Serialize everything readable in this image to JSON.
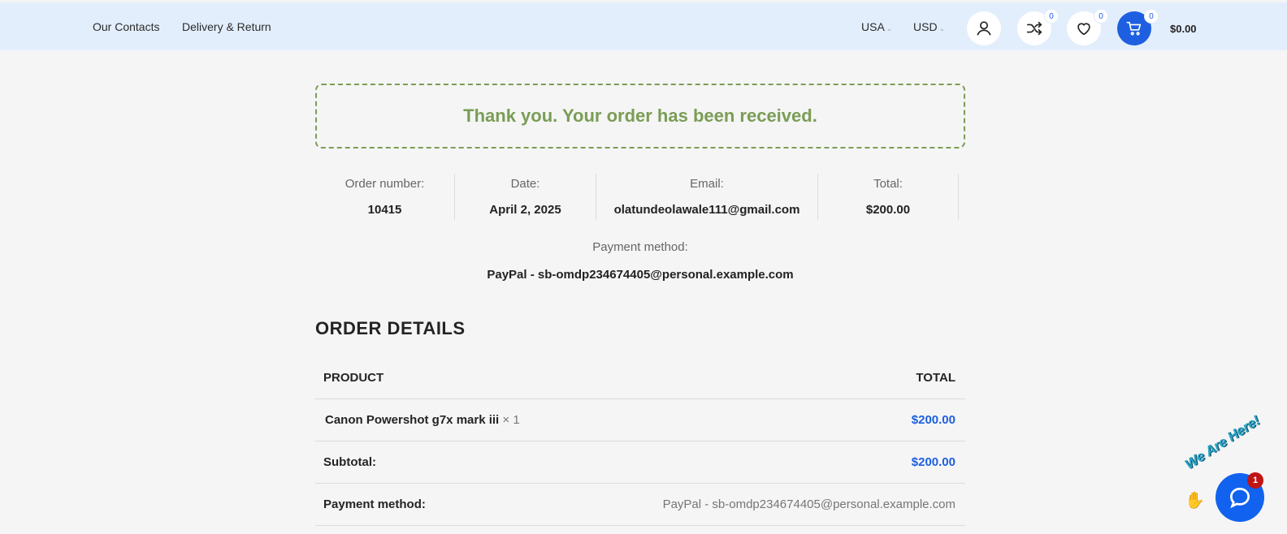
{
  "header": {
    "links": [
      "Our Contacts",
      "Delivery & Return"
    ],
    "country": "USA",
    "currency": "USD",
    "compare_count": "0",
    "wishlist_count": "0",
    "cart_count": "0",
    "cart_total": "$0.00"
  },
  "notice": "Thank you. Your order has been received.",
  "overview": [
    {
      "label": "Order number:",
      "value": "10415"
    },
    {
      "label": "Date:",
      "value": "April 2, 2025"
    },
    {
      "label": "Email:",
      "value": "olatundeolawale111@gmail.com"
    },
    {
      "label": "Total:",
      "value": "$200.00"
    }
  ],
  "payment": {
    "label": "Payment method:",
    "value": "PayPal - sb-omdp234674405@personal.example.com"
  },
  "order_details": {
    "title": "ORDER DETAILS",
    "columns": [
      "PRODUCT",
      "TOTAL"
    ],
    "items": [
      {
        "name": "Canon Powershot g7x mark iii",
        "qty": "× 1",
        "total": "$200.00"
      }
    ],
    "subtotal_label": "Subtotal:",
    "subtotal_value": "$200.00",
    "payment_label": "Payment method:",
    "payment_value": "PayPal - sb-omdp234674405@personal.example.com"
  },
  "chat": {
    "badge": "1",
    "caption": "We Are Here!"
  },
  "colors": {
    "header_bg": "#e3eefc",
    "accent": "#1d5fe0",
    "success": "#7a9d55",
    "chat_badge": "#c01515"
  }
}
